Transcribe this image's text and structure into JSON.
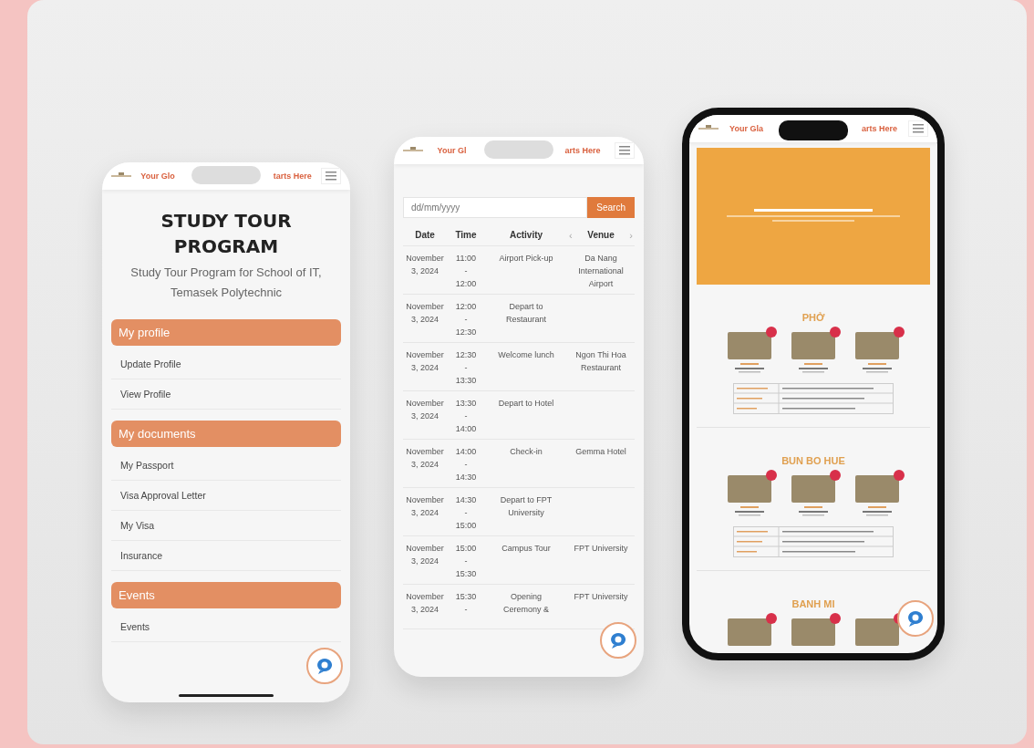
{
  "phones": [
    {
      "kind": "profile",
      "header": {
        "left": "Your Glo",
        "right": "tarts Here"
      },
      "title": "STUDY TOUR PROGRAM",
      "subtitle": "Study Tour Program for School of IT, Temasek Polytechnic",
      "sections": [
        {
          "heading": "My profile",
          "items": [
            "Update Profile",
            "View Profile"
          ]
        },
        {
          "heading": "My documents",
          "items": [
            "My Passport",
            "Visa Approval Letter",
            "My Visa",
            "Insurance"
          ]
        },
        {
          "heading": "Events",
          "items": [
            "Events"
          ]
        }
      ]
    },
    {
      "kind": "schedule",
      "header": {
        "left": "Your Gl",
        "right": "arts Here"
      },
      "search": {
        "placeholder": "dd/mm/yyyy",
        "button": "Search"
      },
      "table": {
        "columns": [
          "Date",
          "Time",
          "Activity",
          "Venue"
        ],
        "prev": "‹",
        "next": "›",
        "rows": [
          {
            "date": "November 3, 2024",
            "time": "11:00 - 12:00",
            "activity": "Airport Pick-up",
            "venue": "Da Nang International Airport"
          },
          {
            "date": "November 3, 2024",
            "time": "12:00 - 12:30",
            "activity": "Depart to Restaurant",
            "venue": ""
          },
          {
            "date": "November 3, 2024",
            "time": "12:30 - 13:30",
            "activity": "Welcome lunch",
            "venue": "Ngon Thi Hoa Restaurant"
          },
          {
            "date": "November 3, 2024",
            "time": "13:30 - 14:00",
            "activity": "Depart to Hotel",
            "venue": ""
          },
          {
            "date": "November 3, 2024",
            "time": "14:00 - 14:30",
            "activity": "Check-in",
            "venue": "Gemma Hotel"
          },
          {
            "date": "November 3, 2024",
            "time": "14:30 - 15:00",
            "activity": "Depart to FPT University",
            "venue": ""
          },
          {
            "date": "November 3, 2024",
            "time": "15:00 - 15:30",
            "activity": "Campus Tour",
            "venue": "FPT University"
          },
          {
            "date": "November 3, 2024",
            "time": "15:30 -",
            "activity": "Opening Ceremony &",
            "venue": "FPT University"
          }
        ]
      }
    },
    {
      "kind": "food",
      "header": {
        "left": "Your Gla",
        "right": "arts Here"
      },
      "sections": [
        {
          "title": "PHỞ",
          "table": true
        },
        {
          "title": "BUN BO HUE",
          "table": true
        },
        {
          "title": "BANH MI",
          "table": false
        }
      ]
    }
  ]
}
